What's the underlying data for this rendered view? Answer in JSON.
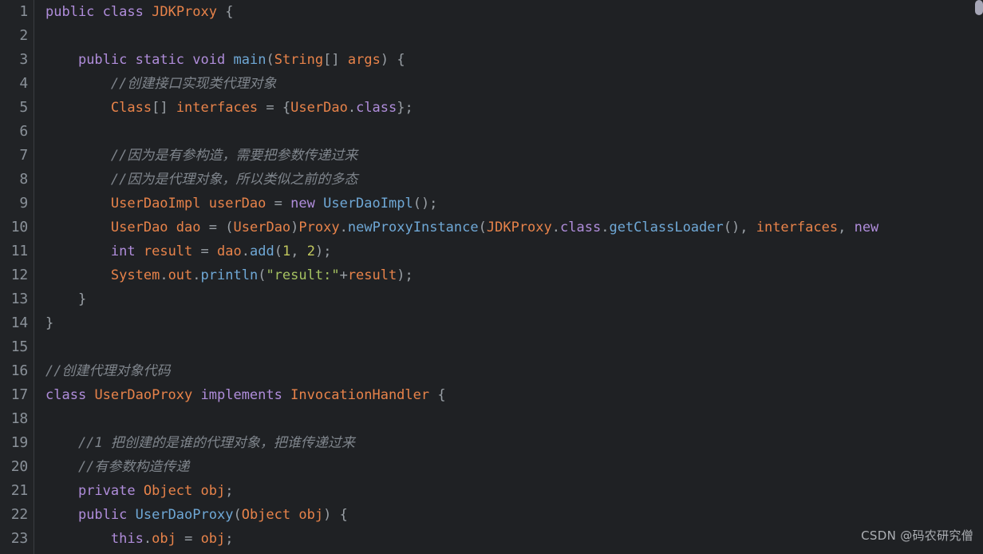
{
  "editor": {
    "language": "java",
    "background_color": "#1f2124",
    "gutter_color": "#212326",
    "line_number_color": "#8a9199",
    "total_visible_lines": 23,
    "first_visible_line": 1,
    "line_numbers": [
      "1",
      "2",
      "3",
      "4",
      "5",
      "6",
      "7",
      "8",
      "9",
      "10",
      "11",
      "12",
      "13",
      "14",
      "15",
      "16",
      "17",
      "18",
      "19",
      "20",
      "21",
      "22",
      "23"
    ]
  },
  "syntax_colors": {
    "keyword": "#b08ddb",
    "type": "#e8834a",
    "identifier": "#e8834a",
    "function": "#6fa8d6",
    "string": "#a5c261",
    "number": "#c3c95e",
    "comment": "#7f858c",
    "punctuation": "#9aa0a6",
    "plain": "#c9cdd2"
  },
  "code_lines": [
    {
      "n": "1",
      "text": "public class JDKProxy {"
    },
    {
      "n": "2",
      "text": ""
    },
    {
      "n": "3",
      "text": "    public static void main(String[] args) {"
    },
    {
      "n": "4",
      "text": "        //创建接口实现类代理对象"
    },
    {
      "n": "5",
      "text": "        Class[] interfaces = {UserDao.class};"
    },
    {
      "n": "6",
      "text": ""
    },
    {
      "n": "7",
      "text": "        //因为是有参构造，需要把参数传递过来"
    },
    {
      "n": "8",
      "text": "        //因为是代理对象，所以类似之前的多态"
    },
    {
      "n": "9",
      "text": "        UserDaoImpl userDao = new UserDaoImpl();"
    },
    {
      "n": "10",
      "text": "        UserDao dao = (UserDao)Proxy.newProxyInstance(JDKProxy.class.getClassLoader(), interfaces, new"
    },
    {
      "n": "11",
      "text": "        int result = dao.add(1, 2);"
    },
    {
      "n": "12",
      "text": "        System.out.println(\"result:\"+result);"
    },
    {
      "n": "13",
      "text": "    }"
    },
    {
      "n": "14",
      "text": "}"
    },
    {
      "n": "15",
      "text": ""
    },
    {
      "n": "16",
      "text": "//创建代理对象代码"
    },
    {
      "n": "17",
      "text": "class UserDaoProxy implements InvocationHandler {"
    },
    {
      "n": "18",
      "text": ""
    },
    {
      "n": "19",
      "text": "    //1 把创建的是谁的代理对象，把谁传递过来"
    },
    {
      "n": "20",
      "text": "    //有参数构造传递"
    },
    {
      "n": "21",
      "text": "    private Object obj;"
    },
    {
      "n": "22",
      "text": "    public UserDaoProxy(Object obj) {"
    },
    {
      "n": "23",
      "text": "        this.obj = obj;"
    }
  ],
  "scrollbar": {
    "thumb_color": "#a6a6b6",
    "position": "top"
  },
  "watermark": {
    "text": "CSDN @码农研究僧"
  }
}
